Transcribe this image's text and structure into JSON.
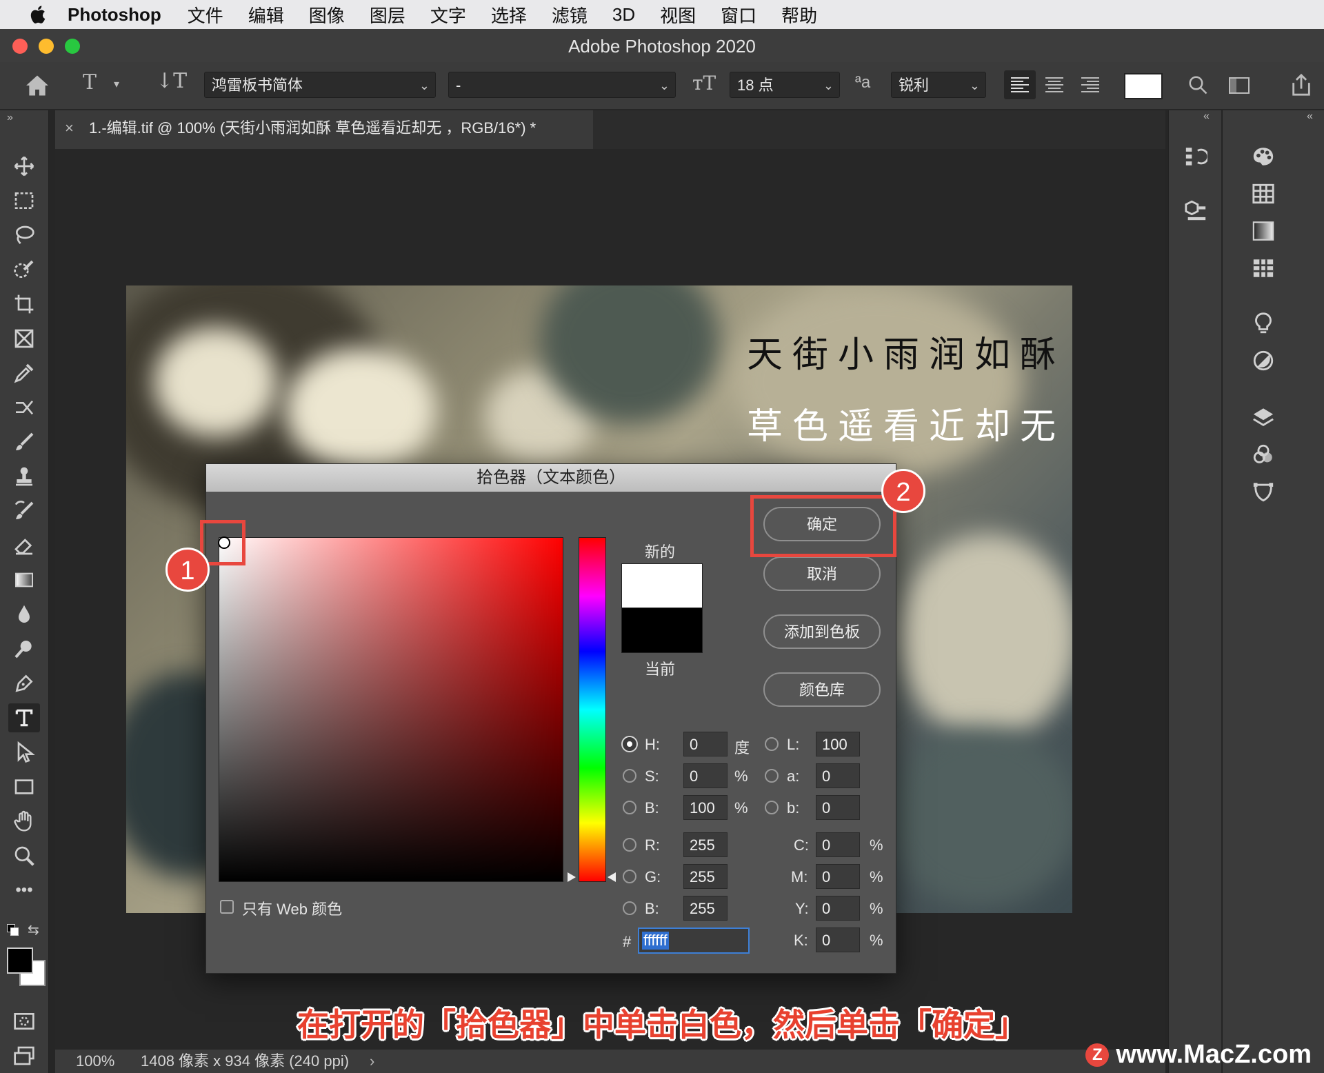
{
  "menubar": {
    "app_name": "Photoshop",
    "items": [
      "文件",
      "编辑",
      "图像",
      "图层",
      "文字",
      "选择",
      "滤镜",
      "3D",
      "视图",
      "窗口",
      "帮助"
    ]
  },
  "window": {
    "title": "Adobe Photoshop 2020"
  },
  "options": {
    "font_family": "鸿雷板书简体",
    "font_style": "-",
    "font_size": "18 点",
    "aa_label": "ªa",
    "antialias": "锐利"
  },
  "document": {
    "tab_title": "1.-编辑.tif @ 100% (天街小雨润如酥 草色遥看近却无 ，RGB/16*) *",
    "poem_line1": "天街小雨润如酥",
    "poem_line2": "草色遥看近却无"
  },
  "status": {
    "zoom": "100%",
    "info": "1408 像素 x 934 像素 (240 ppi)"
  },
  "color_picker": {
    "title": "拾色器（文本颜色）",
    "new_label": "新的",
    "current_label": "当前",
    "new_color": "#ffffff",
    "current_color": "#000000",
    "buttons": {
      "ok": "确定",
      "cancel": "取消",
      "add_to_swatches": "添加到色板",
      "color_libraries": "颜色库"
    },
    "web_only_label": "只有 Web 颜色",
    "fields": {
      "H": {
        "label": "H:",
        "value": "0",
        "unit": "度"
      },
      "S": {
        "label": "S:",
        "value": "0",
        "unit": "%"
      },
      "Bv": {
        "label": "B:",
        "value": "100",
        "unit": "%"
      },
      "R": {
        "label": "R:",
        "value": "255"
      },
      "G": {
        "label": "G:",
        "value": "255"
      },
      "Bb": {
        "label": "B:",
        "value": "255"
      },
      "L": {
        "label": "L:",
        "value": "100"
      },
      "a": {
        "label": "a:",
        "value": "0"
      },
      "b": {
        "label": "b:",
        "value": "0"
      },
      "C": {
        "label": "C:",
        "value": "0",
        "unit": "%"
      },
      "M": {
        "label": "M:",
        "value": "0",
        "unit": "%"
      },
      "Y": {
        "label": "Y:",
        "value": "0",
        "unit": "%"
      },
      "K": {
        "label": "K:",
        "value": "0",
        "unit": "%"
      }
    },
    "hex_label": "#",
    "hex_value": "ffffff"
  },
  "annotations": {
    "callout1": "1",
    "callout2": "2",
    "caption": "在打开的「拾色器」中单击白色，然后单击「确定」",
    "watermark": "www.MacZ.com",
    "watermark_logo": "Z"
  },
  "colors": {
    "accent_red": "#e8473e",
    "dialog_bg": "#535353"
  }
}
